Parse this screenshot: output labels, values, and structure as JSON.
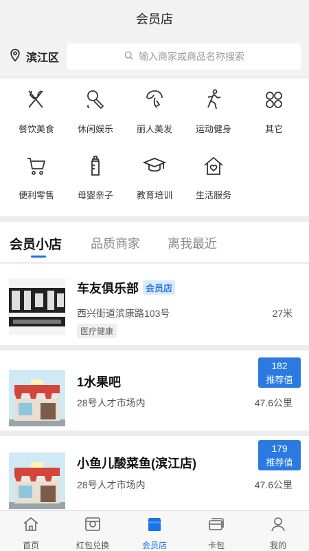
{
  "header": {
    "title": "会员店"
  },
  "location": {
    "city": "滨江区",
    "search_placeholder": "输入商家或商品名称搜索"
  },
  "categories": [
    {
      "label": "餐饮美食",
      "icon": "utensils-icon"
    },
    {
      "label": "休闲娱乐",
      "icon": "microphone-icon"
    },
    {
      "label": "丽人美发",
      "icon": "hair-icon"
    },
    {
      "label": "运动健身",
      "icon": "running-icon"
    },
    {
      "label": "其它",
      "icon": "grid-icon"
    },
    {
      "label": "便利零售",
      "icon": "cart-icon"
    },
    {
      "label": "母婴亲子",
      "icon": "baby-bottle-icon"
    },
    {
      "label": "教育培训",
      "icon": "graduation-cap-icon"
    },
    {
      "label": "生活服务",
      "icon": "home-heart-icon"
    }
  ],
  "tabs": [
    {
      "label": "会员小店"
    },
    {
      "label": "品质商家"
    },
    {
      "label": "离我最近"
    }
  ],
  "shops": [
    {
      "name": "车友俱乐部",
      "badge": "会员店",
      "address": "西兴街道滨康路103号",
      "distance": "27米",
      "tag": "医疗健康"
    },
    {
      "name": "1水果吧",
      "address": "28号人才市场内",
      "distance": "47.6公里",
      "rec_num": "182",
      "rec_label": "推荐值"
    },
    {
      "name": "小鱼儿酸菜鱼(滨江店)",
      "address": "28号人才市场内",
      "distance": "47.6公里",
      "rec_num": "179",
      "rec_label": "推荐值"
    }
  ],
  "tabbar": [
    {
      "label": "首页",
      "icon": "home-icon"
    },
    {
      "label": "红包兑换",
      "icon": "redpacket-icon"
    },
    {
      "label": "会员店",
      "icon": "store-icon"
    },
    {
      "label": "卡包",
      "icon": "cards-icon"
    },
    {
      "label": "我的",
      "icon": "user-icon"
    }
  ],
  "colors": {
    "accent": "#1a73e8",
    "badge_bg": "#d9ebfb",
    "rec_bg": "#2a7ae2"
  }
}
